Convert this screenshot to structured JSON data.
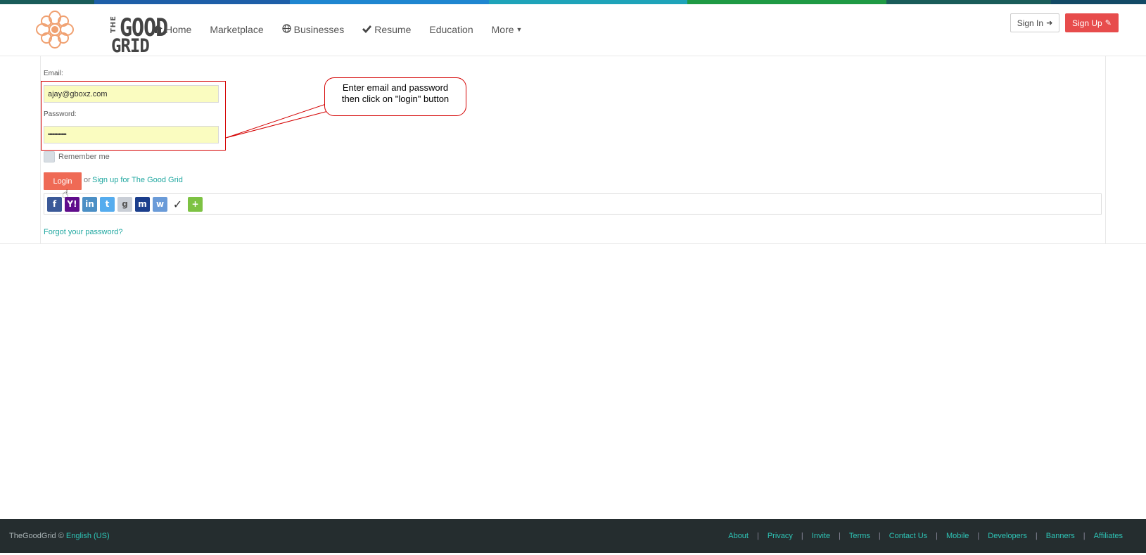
{
  "colors": {
    "stripe": [
      "#1a5c5a",
      "#1e5fa8",
      "#1f86d0",
      "#1ea3b9",
      "#1f9a44",
      "#1a5c5a",
      "#134a66"
    ],
    "accent": "#1fa7a0",
    "signup_button": "#e74c4c",
    "login_button": "#ef6a55",
    "field_bg": "#fafcc0",
    "footer_bg": "#252d2f",
    "annotation": "#d40000"
  },
  "logo": {
    "the": "THE",
    "good": "GOOD",
    "grid": "GRID"
  },
  "nav": [
    {
      "label": "Home",
      "icon": "home-icon"
    },
    {
      "label": "Marketplace",
      "icon": ""
    },
    {
      "label": "Businesses",
      "icon": "globe-icon"
    },
    {
      "label": "Resume",
      "icon": "check-icon"
    },
    {
      "label": "Education",
      "icon": ""
    },
    {
      "label": "More",
      "icon": "caret-down-icon"
    }
  ],
  "header_actions": {
    "sign_in": "Sign In",
    "sign_up": "Sign Up"
  },
  "form": {
    "email_label": "Email:",
    "email_value": "ajay@gboxz.com",
    "password_label": "Password:",
    "password_value": "••••••••••••",
    "remember_label": "Remember me",
    "login_label": "Login",
    "or_text": "or",
    "signup_link": "Sign up for The Good Grid",
    "forgot_link": "Forgot your password?"
  },
  "callout": {
    "line1": "Enter email and password",
    "line2": "then click on \"login\" button"
  },
  "social": [
    {
      "name": "facebook-icon",
      "glyph": "f",
      "color": "#3b5998"
    },
    {
      "name": "yahoo-icon",
      "glyph": "Y!",
      "color": "#5f0c8b"
    },
    {
      "name": "linkedin-icon",
      "glyph": "in",
      "color": "#4b8fc5"
    },
    {
      "name": "twitter-icon",
      "glyph": "t",
      "color": "#55acee"
    },
    {
      "name": "google-icon",
      "glyph": "g",
      "color": "#c9ced6"
    },
    {
      "name": "myspace-icon",
      "glyph": "m",
      "color": "#1b3e8c"
    },
    {
      "name": "windows-live-icon",
      "glyph": "w",
      "color": "#6a9bd8"
    },
    {
      "name": "verisign-icon",
      "glyph": "✓",
      "color": "#ffffff"
    },
    {
      "name": "add-more-icon",
      "glyph": "+",
      "color": "#7dc243"
    }
  ],
  "footer": {
    "brand": "TheGoodGrid ©",
    "language": "English (US)",
    "links": [
      "About",
      "Privacy",
      "Invite",
      "Terms",
      "Contact Us",
      "Mobile",
      "Developers",
      "Banners",
      "Affiliates"
    ]
  }
}
